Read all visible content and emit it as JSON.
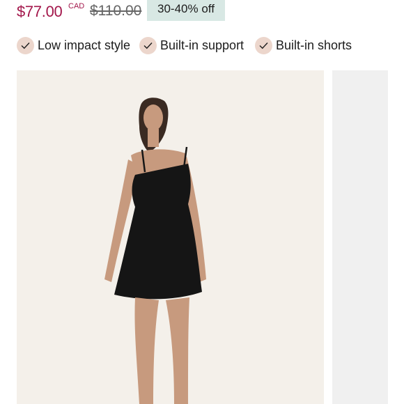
{
  "product": {
    "price_current": "$77.00",
    "currency": "CAD",
    "price_original": "$110.00",
    "discount": "30-40% off"
  },
  "features": [
    {
      "label": "Low impact style",
      "icon": "check-icon"
    },
    {
      "label": "Built-in support",
      "icon": "check-icon"
    },
    {
      "label": "Built-in shorts",
      "icon": "check-icon"
    }
  ],
  "gallery": {
    "main_image": "model-black-dress-photo",
    "next_image": "gallery-next-image"
  },
  "colors": {
    "sale_price": "#a3174b",
    "discount_bg": "#d8e8e4",
    "check_bg": "#ecd6cc",
    "image_bg": "#f4f0ea"
  }
}
